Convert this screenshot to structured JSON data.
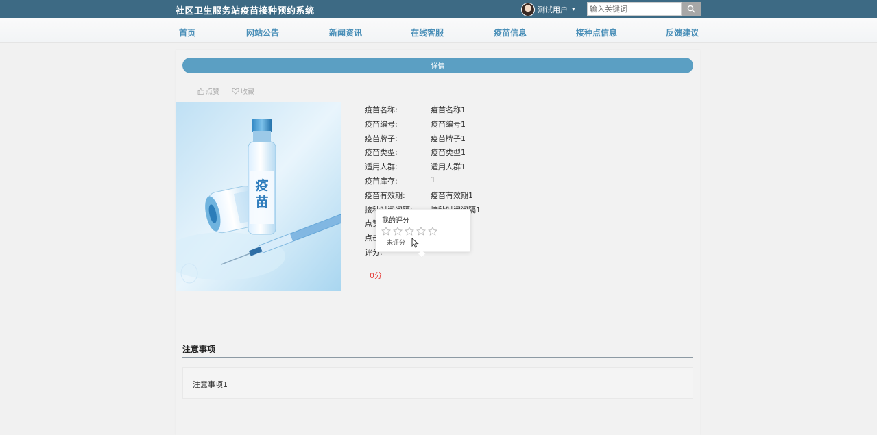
{
  "header": {
    "title": "社区卫生服务站疫苗接种预约系统",
    "user_name": "测试用户",
    "user_caret": "▾",
    "search_placeholder": "输入关键词"
  },
  "nav": {
    "items": [
      {
        "label": "首页"
      },
      {
        "label": "网站公告"
      },
      {
        "label": "新闻资讯"
      },
      {
        "label": "在线客服"
      },
      {
        "label": "疫苗信息"
      },
      {
        "label": "接种点信息"
      },
      {
        "label": "反馈建议"
      }
    ]
  },
  "detail": {
    "banner": "详情",
    "like_label": "点赞",
    "favorite_label": "收藏",
    "image_text": "疫苗",
    "fields": [
      {
        "label": "疫苗名称:",
        "value": "疫苗名称1"
      },
      {
        "label": "疫苗编号:",
        "value": "疫苗编号1"
      },
      {
        "label": "疫苗牌子:",
        "value": "疫苗牌子1"
      },
      {
        "label": "疫苗类型:",
        "value": "疫苗类型1"
      },
      {
        "label": "适用人群:",
        "value": "适用人群1"
      },
      {
        "label": "疫苗库存:",
        "value": "1"
      },
      {
        "label": "疫苗有效期:",
        "value": "疫苗有效期1"
      },
      {
        "label": "接种时间间隔:",
        "value": "接种时间间隔1"
      },
      {
        "label": "点赞",
        "value": ""
      },
      {
        "label": "点击",
        "value": ""
      },
      {
        "label": "评分:",
        "value": ""
      }
    ],
    "score": "0分"
  },
  "rating_popup": {
    "title": "我的评分",
    "status": "未评分",
    "stars_total": 5,
    "stars_selected": 0
  },
  "notes": {
    "title": "注意事项",
    "content": "注意事项1"
  },
  "colors": {
    "header_bg": "#3d6a84",
    "nav_text": "#4a8fb8",
    "banner_bg": "#5b9fc3",
    "score": "#e53935"
  }
}
